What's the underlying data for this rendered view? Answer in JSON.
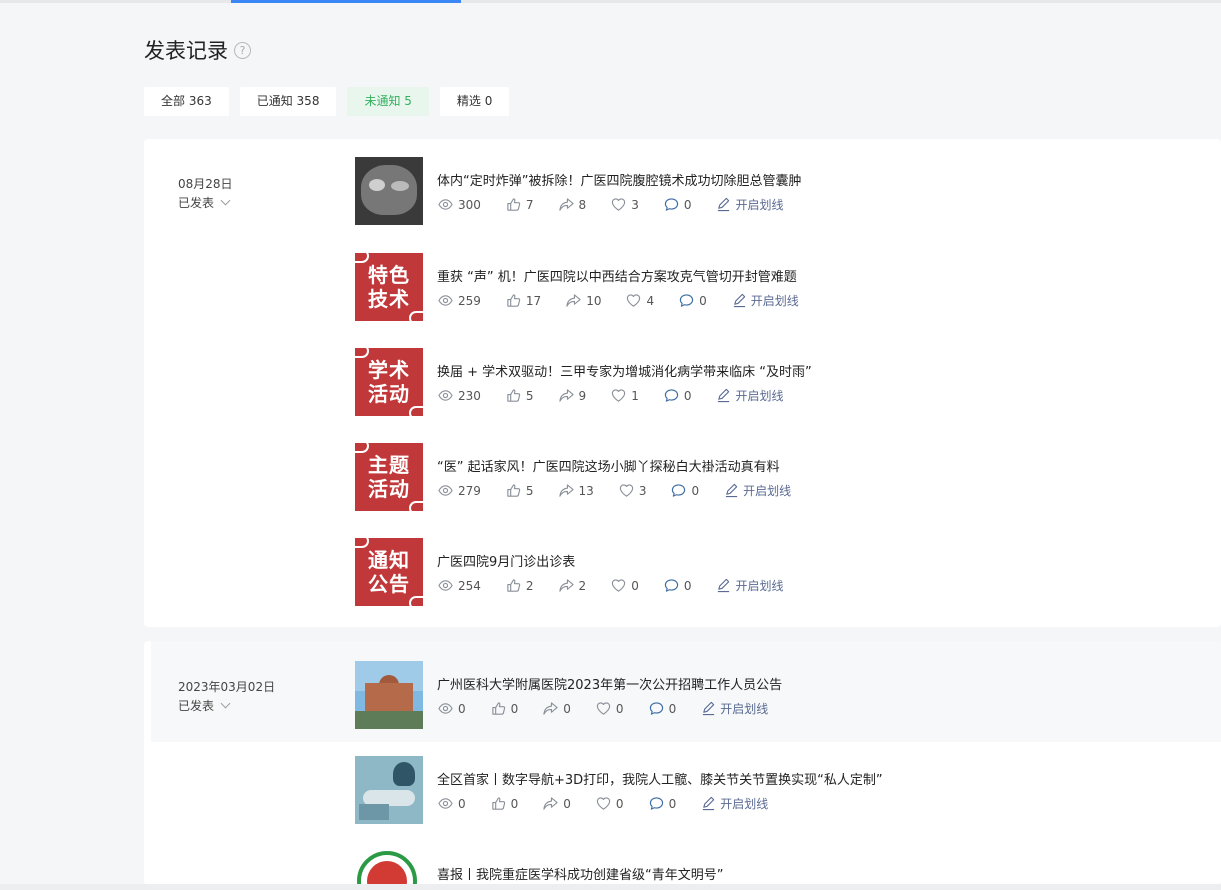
{
  "page": {
    "title": "发表记录",
    "help_icon": "question-icon"
  },
  "filters": [
    {
      "label": "全部 363",
      "active": false
    },
    {
      "label": "已通知 358",
      "active": false
    },
    {
      "label": "未通知 5",
      "active": true
    },
    {
      "label": "精选 0",
      "active": false
    }
  ],
  "groups": [
    {
      "date": "08月28日",
      "status": "已发表",
      "articles": [
        {
          "title": "体内“定时炸弹”被拆除！广医四院腹腔镜术成功切除胆总管囊肿",
          "thumb": "ct-scan-image",
          "views": "300",
          "likes": "7",
          "shares": "8",
          "favs": "3",
          "comments": "0",
          "mark": "开启划线"
        },
        {
          "title": "重获 “声” 机！广医四院以中西结合方案攻克气管切开封管难题",
          "thumb_line1": "特色",
          "thumb_line2": "技术",
          "views": "259",
          "likes": "17",
          "shares": "10",
          "favs": "4",
          "comments": "0",
          "mark": "开启划线"
        },
        {
          "title": "换届 + 学术双驱动！三甲专家为增城消化病学带来临床 “及时雨”",
          "thumb_line1": "学术",
          "thumb_line2": "活动",
          "views": "230",
          "likes": "5",
          "shares": "9",
          "favs": "1",
          "comments": "0",
          "mark": "开启划线"
        },
        {
          "title": "“医” 起话家风！广医四院这场小脚丫探秘白大褂活动真有料",
          "thumb_line1": "主题",
          "thumb_line2": "活动",
          "views": "279",
          "likes": "5",
          "shares": "13",
          "favs": "3",
          "comments": "0",
          "mark": "开启划线"
        },
        {
          "title": "广医四院9月门诊出诊表",
          "thumb_line1": "通知",
          "thumb_line2": "公告",
          "views": "254",
          "likes": "2",
          "shares": "2",
          "favs": "0",
          "comments": "0",
          "mark": "开启划线"
        }
      ]
    },
    {
      "date": "2023年03月02日",
      "status": "已发表",
      "articles": [
        {
          "title": "广州医科大学附属医院2023年第一次公开招聘工作人员公告",
          "thumb": "hospital-building-image",
          "views": "0",
          "likes": "0",
          "shares": "0",
          "favs": "0",
          "comments": "0",
          "mark": "开启划线"
        },
        {
          "title": "全区首家丨数字导航+3D打印，我院人工髋、膝关节关节置换实现“私人定制”",
          "thumb": "surgery-image",
          "views": "0",
          "likes": "0",
          "shares": "0",
          "favs": "0",
          "comments": "0",
          "mark": "开启划线"
        },
        {
          "title": "喜报丨我院重症医学科成功创建省级“青年文明号”",
          "thumb": "youth-badge-image"
        }
      ]
    }
  ],
  "icons": {
    "views": "eye-icon",
    "likes": "thumbs-up-icon",
    "shares": "share-icon",
    "favs": "heart-icon",
    "comments": "comment-icon",
    "mark": "pencil-icon"
  },
  "colors": {
    "accent_tab": "#3a87f5",
    "active_filter_bg": "#e8f6ed",
    "active_filter_text": "#35b15f",
    "thumb_red": "#c1383b",
    "mark_text": "#5a6a92"
  }
}
